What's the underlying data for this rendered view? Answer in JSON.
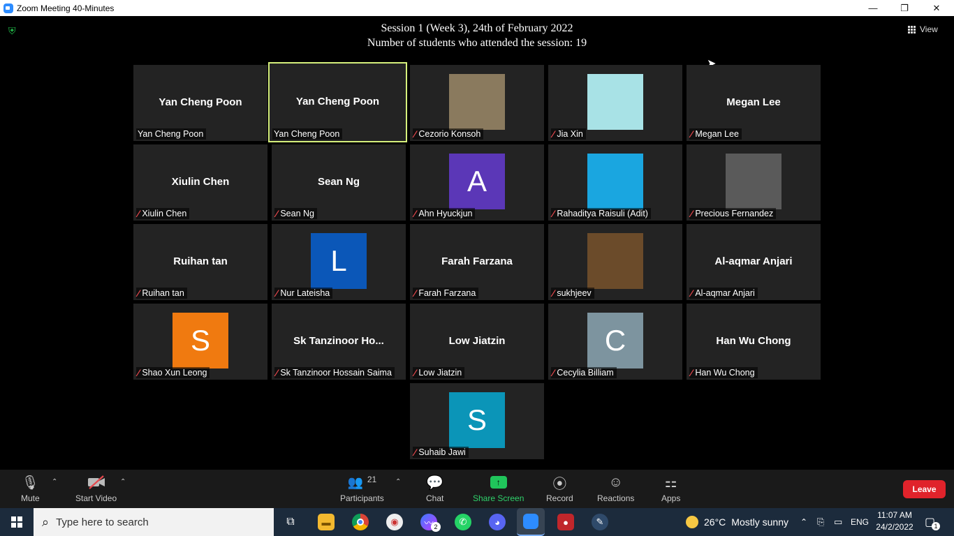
{
  "window": {
    "title": "Zoom Meeting 40-Minutes",
    "minimize_glyph": "—",
    "maximize_glyph": "❐",
    "close_glyph": "✕"
  },
  "meeting": {
    "session_line1": "Session 1 (Week 3), 24th of February 2022",
    "session_line2": "Number of students who attended the session: 19",
    "view_label": "View"
  },
  "tiles": [
    {
      "name": "Yan Cheng Poon",
      "label": "Yan Cheng Poon",
      "muted": false,
      "type": "name"
    },
    {
      "name": "Yan Cheng Poon",
      "label": "Yan Cheng Poon",
      "muted": false,
      "type": "name",
      "active": true
    },
    {
      "name": "Cezorio Konsoh",
      "label": "Cezorio Konsoh",
      "muted": true,
      "type": "photo",
      "color": "#8a7a5e"
    },
    {
      "name": "Jia Xin",
      "label": "Jia Xin",
      "muted": true,
      "type": "photo",
      "color": "#a8e2e6"
    },
    {
      "name": "Megan Lee",
      "label": "Megan Lee",
      "muted": true,
      "type": "name"
    },
    {
      "name": "Xiulin Chen",
      "label": "Xiulin Chen",
      "muted": true,
      "type": "name"
    },
    {
      "name": "Sean Ng",
      "label": "Sean Ng",
      "muted": true,
      "type": "name"
    },
    {
      "name": "A",
      "label": "Ahn Hyuckjun",
      "muted": true,
      "type": "letter",
      "color": "#5b37b7"
    },
    {
      "name": "Rahaditya Raisuli (Adit)",
      "label": "Rahaditya Raisuli (Adit)",
      "muted": true,
      "type": "photo",
      "color": "#1aa6e0"
    },
    {
      "name": "Precious Fernandez",
      "label": "Precious Fernandez",
      "muted": true,
      "type": "photo",
      "color": "#5a5a5a"
    },
    {
      "name": "Ruihan tan",
      "label": "Ruihan tan",
      "muted": true,
      "type": "name"
    },
    {
      "name": "L",
      "label": "Nur Lateisha",
      "muted": true,
      "type": "letter",
      "color": "#0b57b8"
    },
    {
      "name": "Farah Farzana",
      "label": "Farah Farzana",
      "muted": true,
      "type": "name"
    },
    {
      "name": "sukhjeev",
      "label": "sukhjeev",
      "muted": true,
      "type": "photo",
      "color": "#6b4b2a"
    },
    {
      "name": "Al-aqmar Anjari",
      "label": "Al-aqmar Anjari",
      "muted": true,
      "type": "name"
    },
    {
      "name": "S",
      "label": "Shao Xun Leong",
      "muted": true,
      "type": "letter",
      "color": "#f07a10"
    },
    {
      "name": "Sk  Tanzinoor  Ho...",
      "label": "Sk Tanzinoor Hossain Saima",
      "muted": true,
      "type": "name"
    },
    {
      "name": "Low Jiatzin",
      "label": "Low Jiatzin",
      "muted": true,
      "type": "name"
    },
    {
      "name": "C",
      "label": "Cecylia Billiam",
      "muted": true,
      "type": "letter",
      "color": "#7d949f"
    },
    {
      "name": "Han Wu Chong",
      "label": "Han Wu Chong",
      "muted": true,
      "type": "name"
    },
    {
      "name": "S",
      "label": "Suhaib Jawi",
      "muted": true,
      "type": "letter",
      "color": "#0b95b8"
    }
  ],
  "toolbar": {
    "mute_label": "Mute",
    "video_label": "Start Video",
    "participants_label": "Participants",
    "participants_count": "21",
    "chat_label": "Chat",
    "share_label": "Share Screen",
    "record_label": "Record",
    "reactions_label": "Reactions",
    "apps_label": "Apps",
    "leave_label": "Leave"
  },
  "taskbar": {
    "search_placeholder": "Type here to search",
    "weather_temp": "26°C",
    "weather_text": "Mostly sunny",
    "language": "ENG",
    "time": "11:07 AM",
    "date": "24/2/2022",
    "messenger_badge": "2",
    "notification_count": "1"
  },
  "colors": {
    "share_green": "#20c55b",
    "leave_red": "#e0232b",
    "active_speaker_border": "#d6f07c",
    "tile_bg": "#232323"
  }
}
